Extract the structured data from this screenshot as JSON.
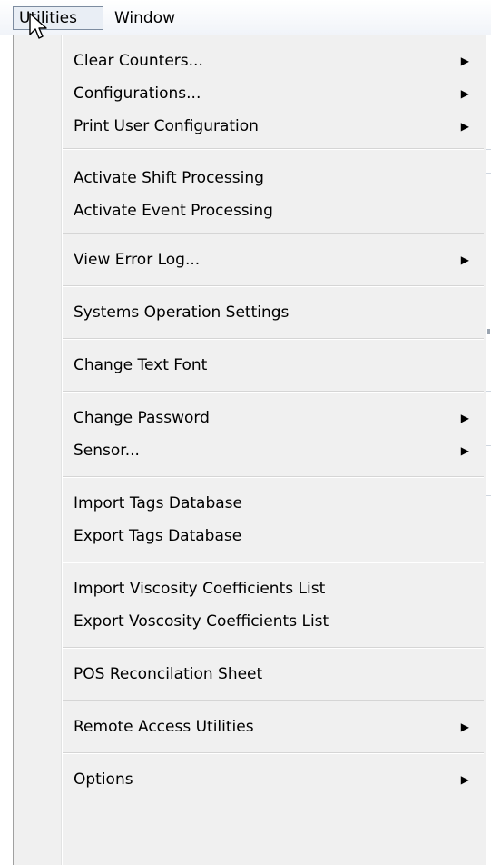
{
  "menubar": {
    "items": [
      {
        "label": "Utilities",
        "active": true
      },
      {
        "label": "Window",
        "active": false
      }
    ]
  },
  "utilities_menu": {
    "items": [
      {
        "label": "Clear Counters...",
        "submenu": true
      },
      {
        "label": "Configurations...",
        "submenu": true
      },
      {
        "label": "Print User Configuration",
        "submenu": true
      },
      {
        "label": "Activate Shift Processing",
        "submenu": false
      },
      {
        "label": "Activate Event Processing",
        "submenu": false
      },
      {
        "label": "View Error Log...",
        "submenu": true
      },
      {
        "label": "Systems Operation Settings",
        "submenu": false
      },
      {
        "label": "Change Text Font",
        "submenu": false
      },
      {
        "label": "Change Password",
        "submenu": true
      },
      {
        "label": "Sensor...",
        "submenu": true
      },
      {
        "label": "Import Tags Database",
        "submenu": false
      },
      {
        "label": "Export Tags Database",
        "submenu": false
      },
      {
        "label": "Import Viscosity Coefficients List",
        "submenu": false
      },
      {
        "label": "Export Voscosity Coefficients List",
        "submenu": false
      },
      {
        "label": "POS Reconcilation Sheet",
        "submenu": false
      },
      {
        "label": "Remote Access Utilities",
        "submenu": true
      },
      {
        "label": "Options",
        "submenu": true
      }
    ],
    "submenu_arrow": "▶"
  },
  "icons": {
    "cursor": "mouse-pointer-icon",
    "submenu": "submenu-arrow-icon"
  },
  "colors": {
    "menu_background": "#f0f0f0",
    "active_menubar_background": "#e9eef5",
    "active_menubar_border": "#7d8ca0"
  }
}
